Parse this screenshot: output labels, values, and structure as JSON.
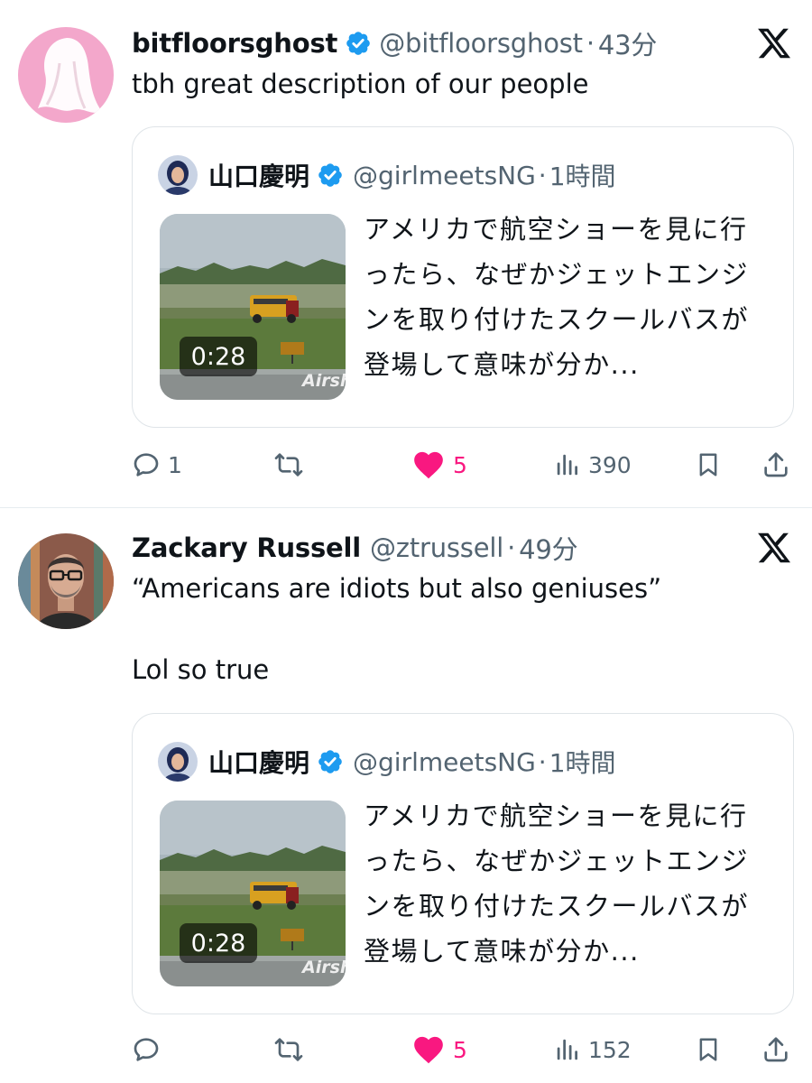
{
  "posts": [
    {
      "name": "bitfloorsghost",
      "verified": true,
      "handle": "@bitfloorsghost",
      "separator": "·",
      "time": "43分",
      "lines": [
        "tbh great description of our people"
      ],
      "quote": {
        "name": "山口慶明",
        "verified": true,
        "handle": "@girlmeetsNG",
        "separator": "·",
        "time": "1時間",
        "duration": "0:28",
        "watermark": "Airsh",
        "text": "アメリカで航空ショーを見に行ったら、なぜかジェットエンジンを取り付けたスクールバスが登場して意味が分か..."
      },
      "actions": {
        "replies": "1",
        "reposts": "",
        "likes": "5",
        "views": "390"
      }
    },
    {
      "name": "Zackary Russell",
      "verified": false,
      "handle": "@ztrussell",
      "separator": "·",
      "time": "49分",
      "lines": [
        "“Americans are idiots but also geniuses”",
        "Lol so true"
      ],
      "quote": {
        "name": "山口慶明",
        "verified": true,
        "handle": "@girlmeetsNG",
        "separator": "·",
        "time": "1時間",
        "duration": "0:28",
        "watermark": "Airsh",
        "text": "アメリカで航空ショーを見に行ったら、なぜかジェットエンジンを取り付けたスクールバスが登場して意味が分か..."
      },
      "actions": {
        "replies": "",
        "reposts": "",
        "likes": "5",
        "views": "152"
      }
    }
  ],
  "colors": {
    "text": "#0f1419",
    "secondary": "#536471",
    "like": "#f91880",
    "verified": "#1d9bf0",
    "border": "#dfe4e8"
  },
  "icons": [
    "verified-badge-icon",
    "x-logo-icon",
    "reply-icon",
    "repost-icon",
    "like-icon",
    "views-icon",
    "bookmark-icon",
    "share-icon"
  ]
}
